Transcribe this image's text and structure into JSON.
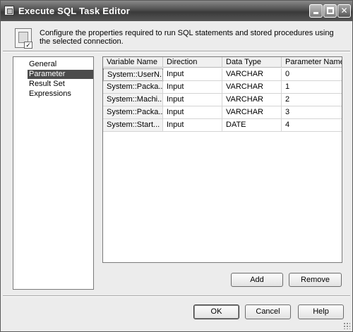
{
  "window": {
    "title": "Execute SQL Task Editor",
    "icon": "task-editor-icon",
    "controls": {
      "minimize_icon": "minimize-icon",
      "maximize_icon": "maximize-icon",
      "close_icon": "close-icon",
      "close_glyph": "✕"
    }
  },
  "header": {
    "icon": "sql-task-icon",
    "description": "Configure the properties required to run SQL statements and stored procedures using the selected connection."
  },
  "nav": {
    "items": [
      {
        "label": "General"
      },
      {
        "label": "Parameter Mapping"
      },
      {
        "label": "Result Set"
      },
      {
        "label": "Expressions"
      }
    ],
    "selected": "Parameter Mapping"
  },
  "grid": {
    "columns": [
      "Variable Name",
      "Direction",
      "Data Type",
      "Parameter Name"
    ],
    "rows": [
      [
        "System::UserN...",
        "Input",
        "VARCHAR",
        "0"
      ],
      [
        "System::Packa...",
        "Input",
        "VARCHAR",
        "1"
      ],
      [
        "System::Machi...",
        "Input",
        "VARCHAR",
        "2"
      ],
      [
        "System::Packa...",
        "Input",
        "VARCHAR",
        "3"
      ],
      [
        "System::Start...",
        "Input",
        "DATE",
        "4"
      ]
    ]
  },
  "buttons": {
    "add": "Add",
    "remove": "Remove",
    "ok": "OK",
    "cancel": "Cancel",
    "help": "Help"
  },
  "colors": {
    "titlebar": "#4e4e4e",
    "selection": "#4c4c4c",
    "dialog_bg": "#ececec"
  }
}
